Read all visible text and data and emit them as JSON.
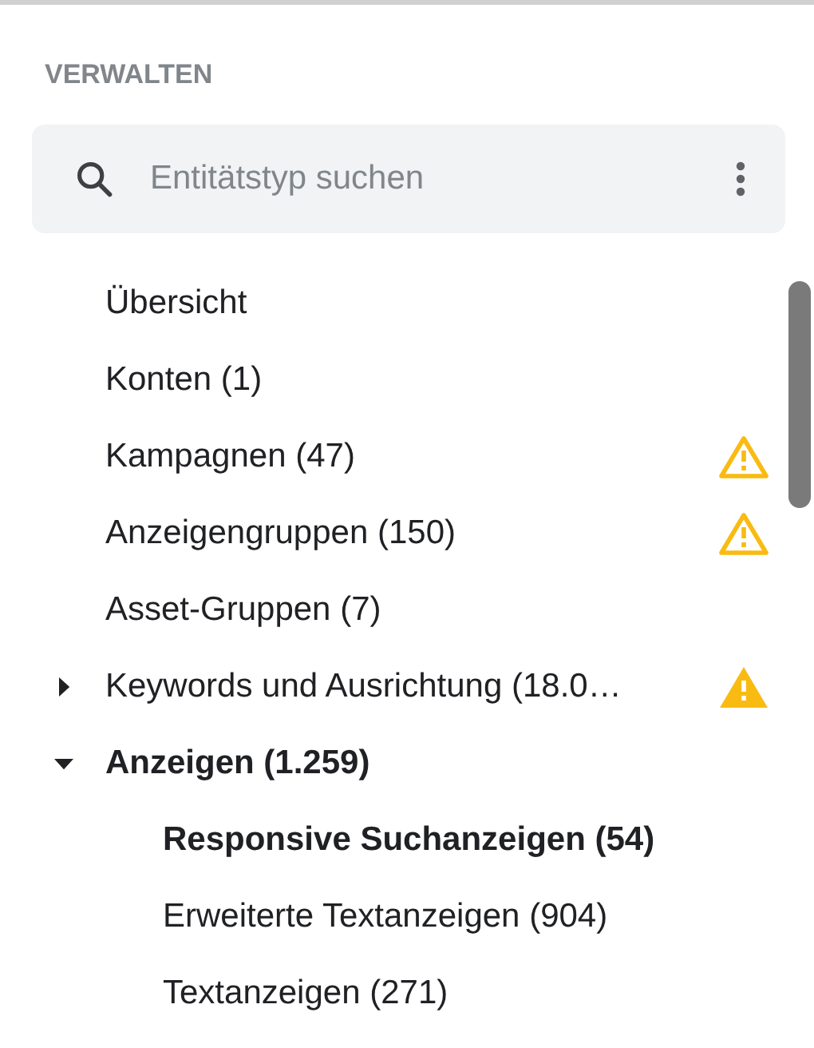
{
  "heading": "VERWALTEN",
  "search": {
    "placeholder": "Entitätstyp suchen"
  },
  "items": [
    {
      "label": "Übersicht",
      "selected": false
    },
    {
      "label": "Konten (1)",
      "selected": false
    },
    {
      "label": "Kampagnen (47)",
      "selected": false,
      "warning": {
        "kind": "outline"
      }
    },
    {
      "label": "Anzeigengruppen (150)",
      "selected": false,
      "warning": {
        "kind": "outline"
      }
    },
    {
      "label": "Asset-Gruppen (7)",
      "selected": false
    },
    {
      "label": "Keywords und Ausrichtung (18.0…",
      "selected": false,
      "expanded": false,
      "warning": {
        "kind": "filled"
      }
    },
    {
      "label": "Anzeigen (1.259)",
      "selected": true,
      "expanded": true,
      "children": [
        {
          "label": "Responsive Suchanzeigen (54)",
          "selected": true
        },
        {
          "label": "Erweiterte Textanzeigen (904)",
          "selected": false
        },
        {
          "label": "Textanzeigen (271)",
          "selected": false
        }
      ]
    }
  ]
}
